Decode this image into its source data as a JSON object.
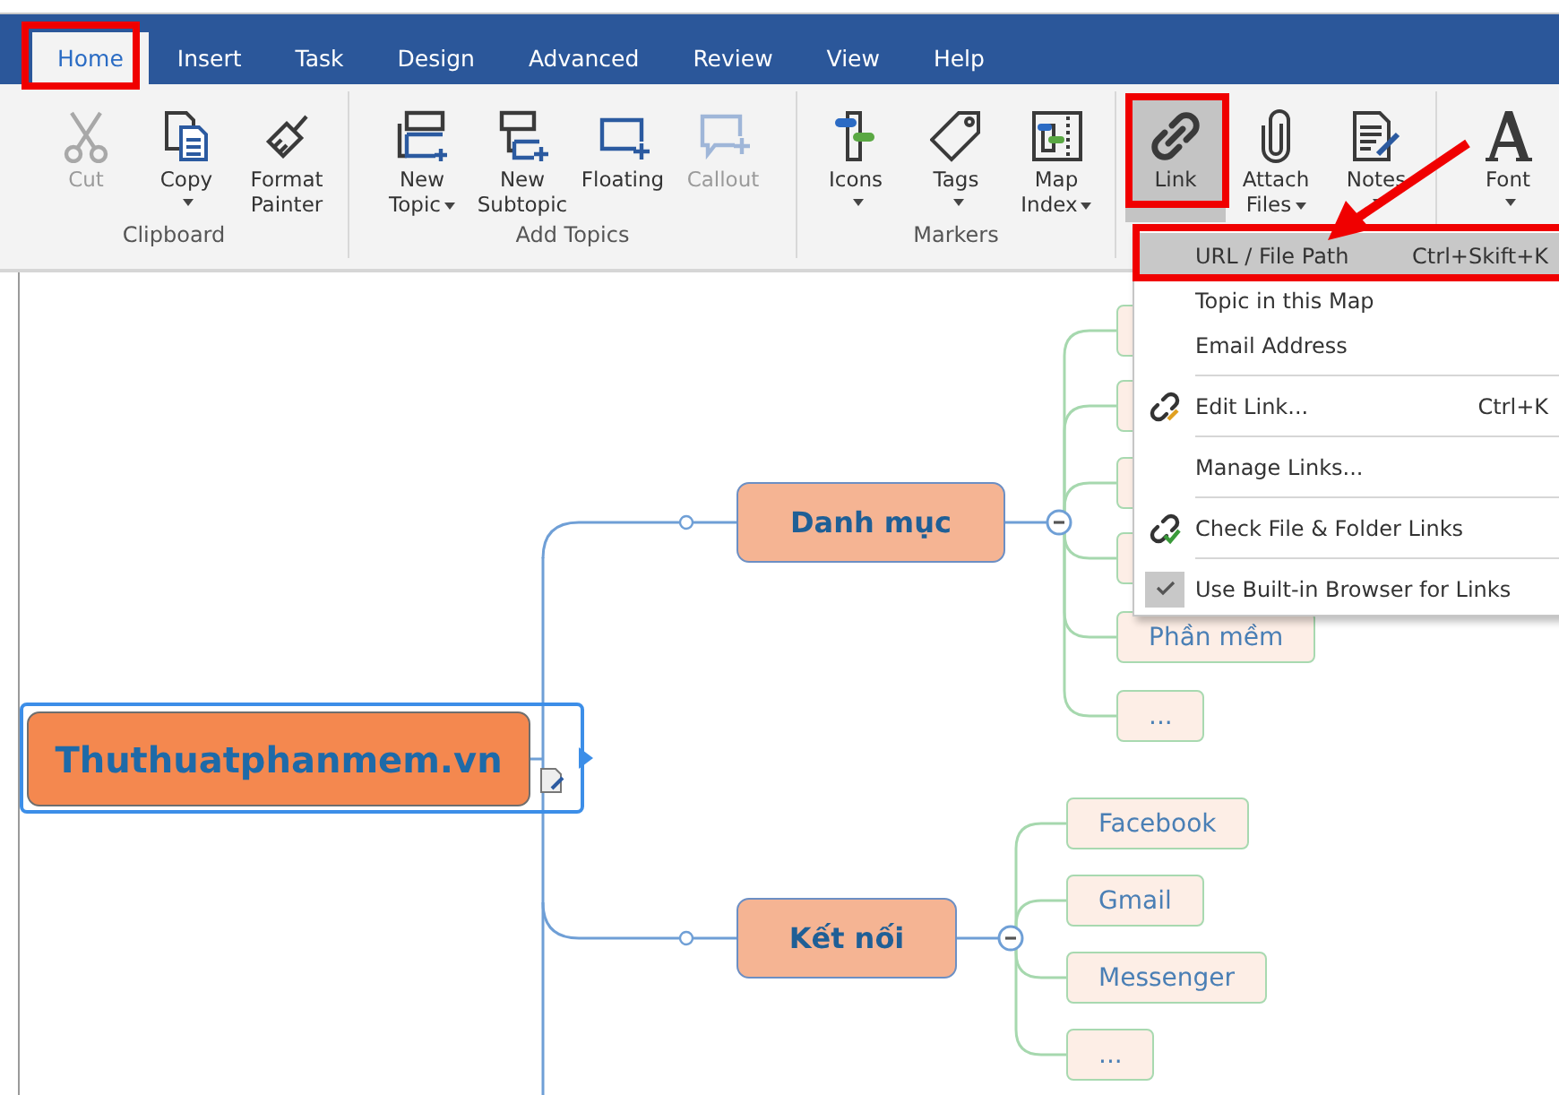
{
  "tabs": [
    {
      "label": "Home",
      "selected": true
    },
    {
      "label": "Insert",
      "selected": false
    },
    {
      "label": "Task",
      "selected": false
    },
    {
      "label": "Design",
      "selected": false
    },
    {
      "label": "Advanced",
      "selected": false
    },
    {
      "label": "Review",
      "selected": false
    },
    {
      "label": "View",
      "selected": false
    },
    {
      "label": "Help",
      "selected": false
    }
  ],
  "ribbon": {
    "groups": [
      {
        "label": "Clipboard",
        "buttons": [
          {
            "label": [
              "Cut"
            ],
            "disabled": true,
            "dropdown": false,
            "pressed": false
          },
          {
            "label": [
              "Copy"
            ],
            "disabled": false,
            "dropdown": true,
            "pressed": false
          },
          {
            "label": [
              "Format",
              "Painter"
            ],
            "disabled": false,
            "dropdown": false,
            "pressed": false
          }
        ]
      },
      {
        "label": "Add Topics",
        "buttons": [
          {
            "label": [
              "New",
              "Topic"
            ],
            "disabled": false,
            "dropdown": true,
            "pressed": false
          },
          {
            "label": [
              "New",
              "Subtopic"
            ],
            "disabled": false,
            "dropdown": false,
            "pressed": false
          },
          {
            "label": [
              "Floating"
            ],
            "disabled": false,
            "dropdown": false,
            "pressed": false
          },
          {
            "label": [
              "Callout"
            ],
            "disabled": true,
            "dropdown": false,
            "pressed": false
          }
        ]
      },
      {
        "label": "Markers",
        "buttons": [
          {
            "label": [
              "Icons"
            ],
            "disabled": false,
            "dropdown": true,
            "pressed": false
          },
          {
            "label": [
              "Tags"
            ],
            "disabled": false,
            "dropdown": true,
            "pressed": false
          },
          {
            "label": [
              "Map",
              "Index"
            ],
            "disabled": false,
            "dropdown": true,
            "pressed": false
          }
        ]
      },
      {
        "buttons": [
          {
            "label": [
              "Link"
            ],
            "disabled": false,
            "dropdown": false,
            "pressed": true
          },
          {
            "label": [
              "Attach",
              "Files"
            ],
            "disabled": false,
            "dropdown": true,
            "pressed": false
          },
          {
            "label": [
              "Notes"
            ],
            "disabled": false,
            "dropdown": true,
            "pressed": false
          }
        ]
      },
      {
        "buttons": [
          {
            "label": [
              "Font"
            ],
            "disabled": false,
            "dropdown": true,
            "pressed": false
          }
        ]
      }
    ]
  },
  "map": {
    "central": {
      "text": "Thuthuatphanmem.vn",
      "selected": true,
      "has_note": true
    },
    "topics": [
      {
        "text": "Danh mục",
        "expanded": true,
        "children": [
          {
            "kind": "covered"
          },
          {
            "kind": "covered"
          },
          {
            "kind": "covered"
          },
          {
            "kind": "covered"
          },
          {
            "kind": "node",
            "text": "Phần mềm"
          },
          {
            "kind": "node",
            "text": "..."
          }
        ]
      },
      {
        "text": "Kết nối",
        "expanded": true,
        "children": [
          {
            "kind": "node",
            "text": "Facebook"
          },
          {
            "kind": "node",
            "text": "Gmail"
          },
          {
            "kind": "node",
            "text": "Messenger"
          },
          {
            "kind": "node",
            "text": "..."
          }
        ]
      }
    ]
  },
  "menu": {
    "items": [
      {
        "kind": "plain",
        "label": "URL / File Path",
        "shortcut": "Ctrl+Skift+K",
        "selected": true,
        "separator_before": false
      },
      {
        "kind": "plain",
        "label": "Topic in this Map",
        "selected": false,
        "separator_before": false
      },
      {
        "kind": "plain",
        "label": "Email Address",
        "selected": false,
        "separator_before": false
      },
      {
        "kind": "edit-link",
        "label": "Edit Link...",
        "shortcut": "Ctrl+K",
        "selected": false,
        "separator_before": true
      },
      {
        "kind": "plain",
        "label": "Manage Links...",
        "selected": false,
        "separator_before": true
      },
      {
        "kind": "check-link",
        "label": "Check File & Folder Links",
        "selected": false,
        "separator_before": true
      },
      {
        "kind": "toggle",
        "label": "Use Built-in Browser for Links",
        "checked": true,
        "selected": false,
        "separator_before": true
      }
    ]
  },
  "annotations": [
    {
      "kind": "frame"
    },
    {
      "kind": "frame"
    },
    {
      "kind": "frame"
    },
    {
      "kind": "arrow"
    }
  ]
}
